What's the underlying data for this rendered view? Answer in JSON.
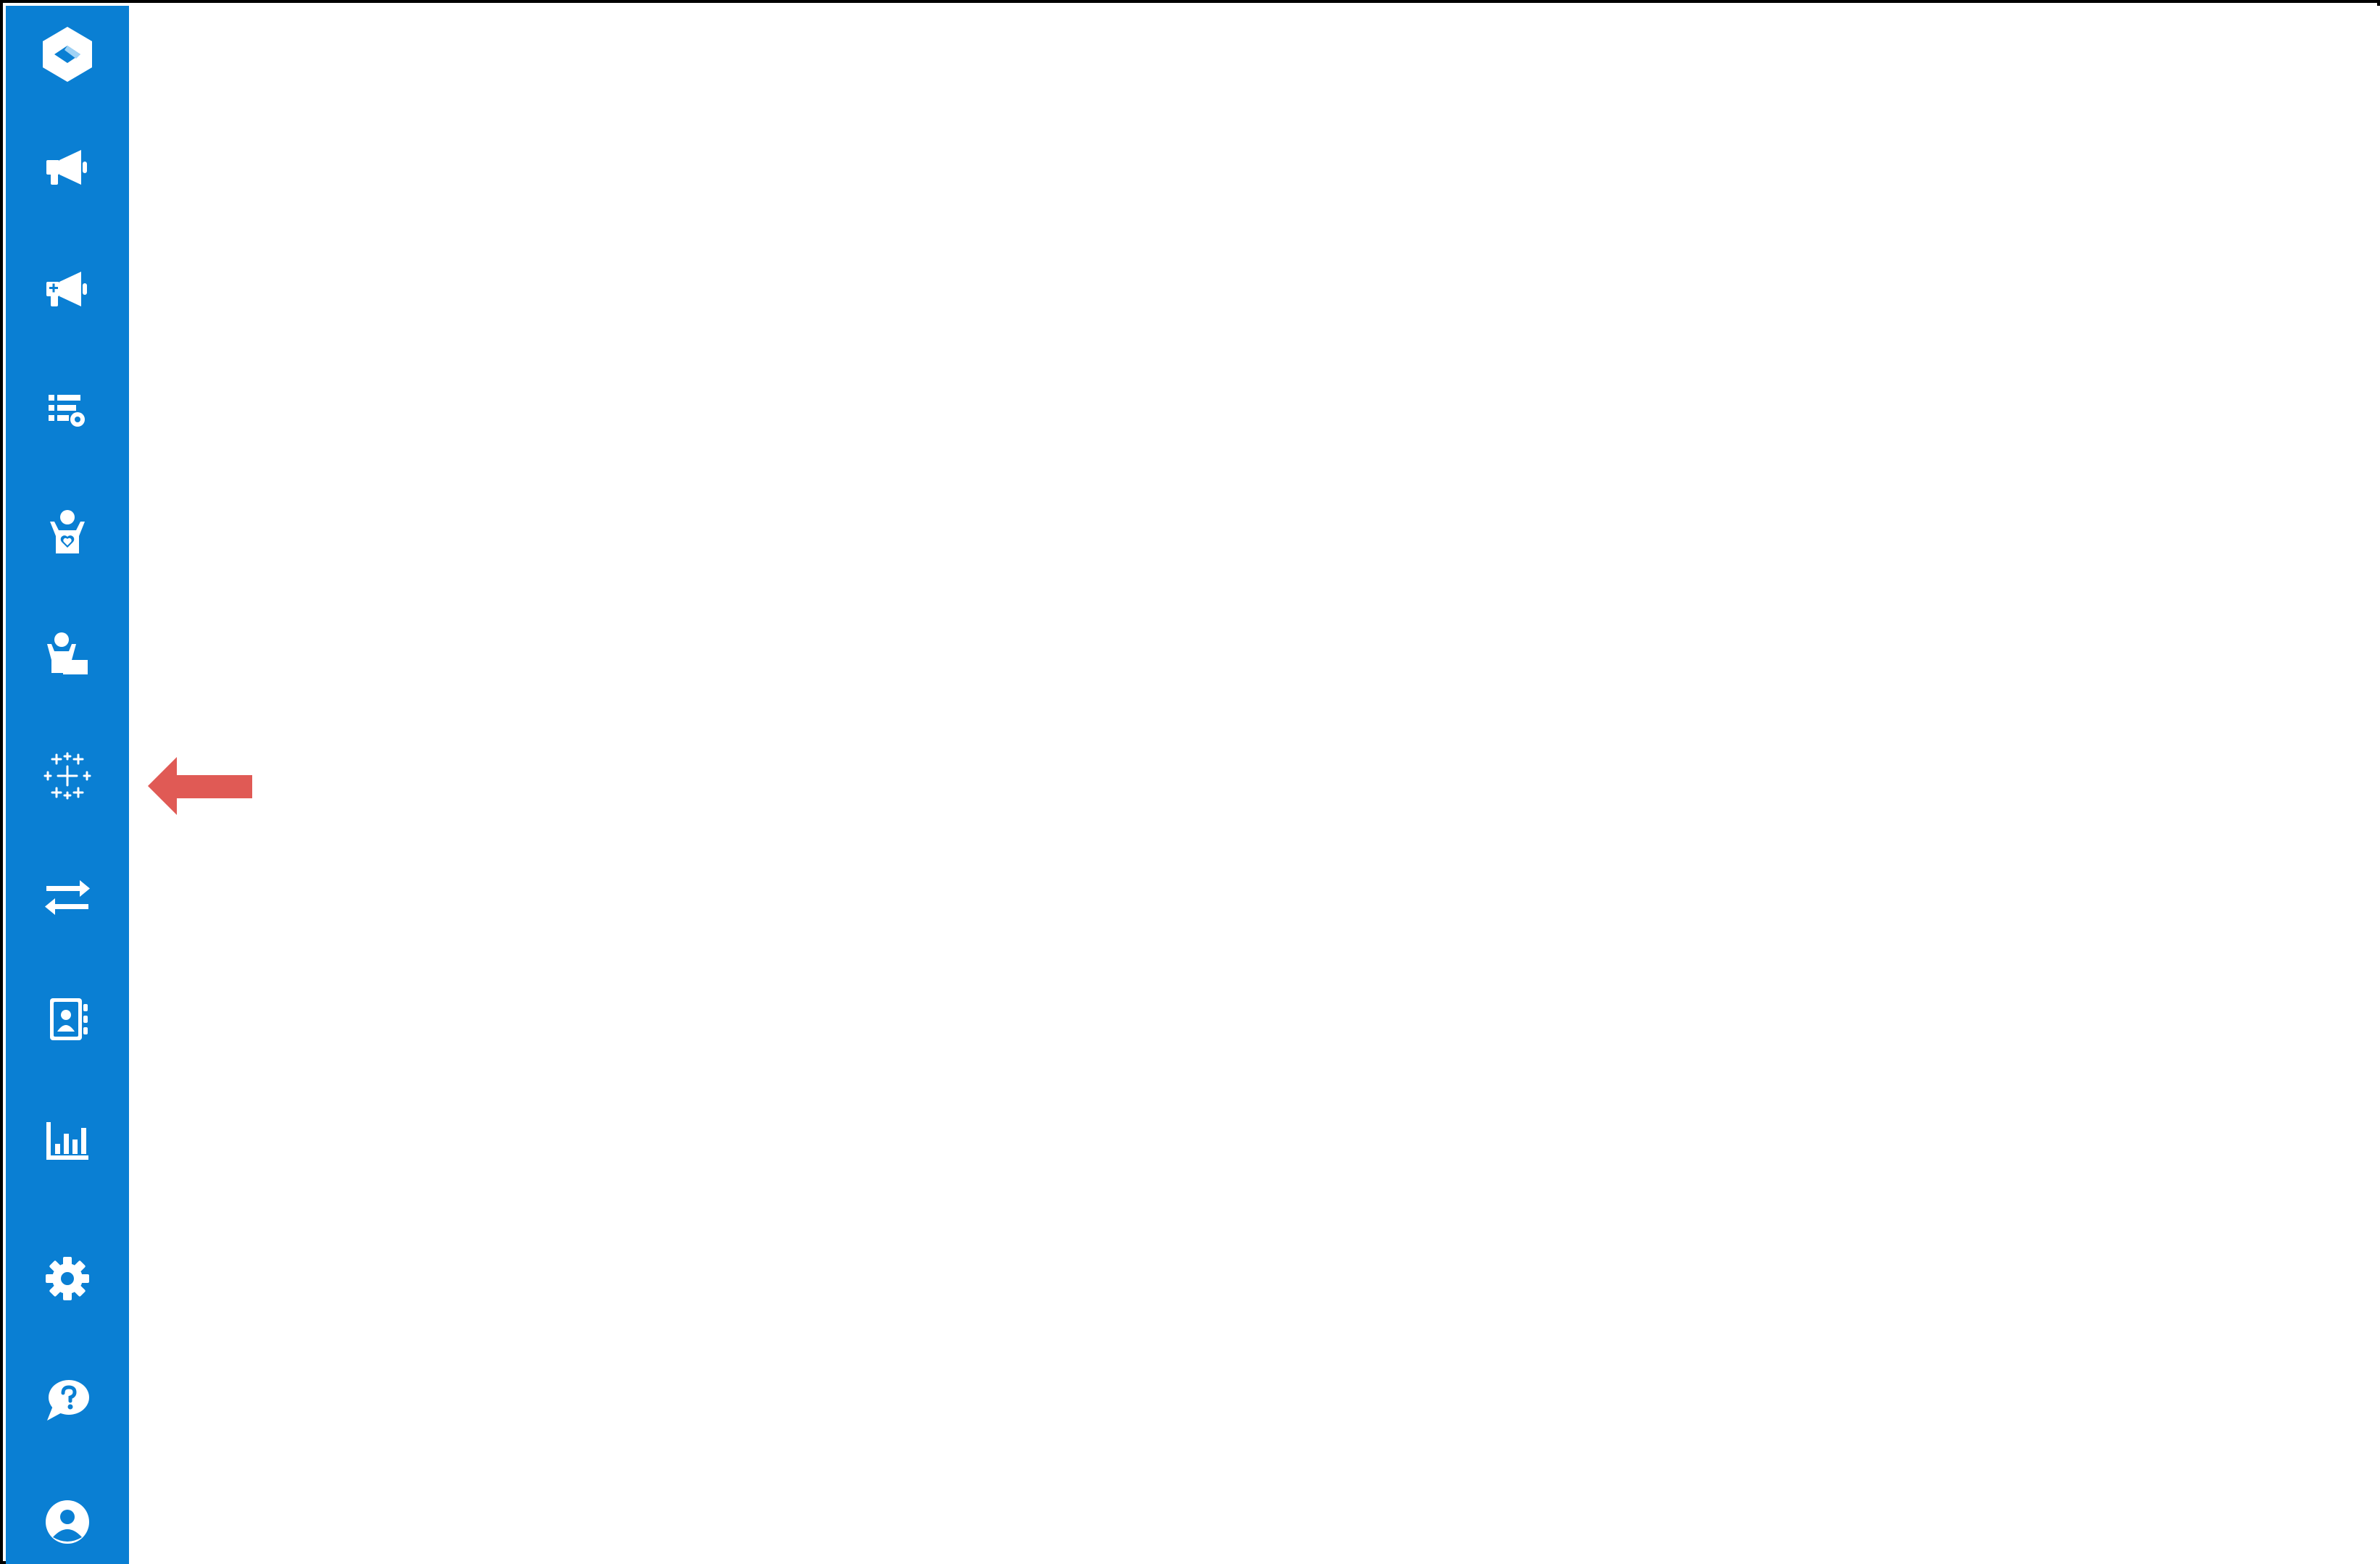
{
  "app": {
    "accent_color": "#0a7fd3",
    "callout_color": "#e05a55"
  },
  "sidebar": {
    "items": [
      {
        "icon": "logo-icon"
      },
      {
        "icon": "megaphone-icon"
      },
      {
        "icon": "megaphone-plus-icon"
      },
      {
        "icon": "list-settings-icon"
      },
      {
        "icon": "person-heart-icon"
      },
      {
        "icon": "person-desk-icon"
      },
      {
        "icon": "sparkle-plus-grid-icon",
        "highlighted": true
      },
      {
        "icon": "transfer-arrows-icon"
      },
      {
        "icon": "contact-book-icon"
      },
      {
        "icon": "bar-chart-icon"
      },
      {
        "icon": "gear-icon"
      },
      {
        "icon": "help-chat-icon"
      },
      {
        "icon": "user-circle-icon"
      }
    ]
  },
  "annotation": {
    "icon": "callout-arrow-left-icon"
  }
}
